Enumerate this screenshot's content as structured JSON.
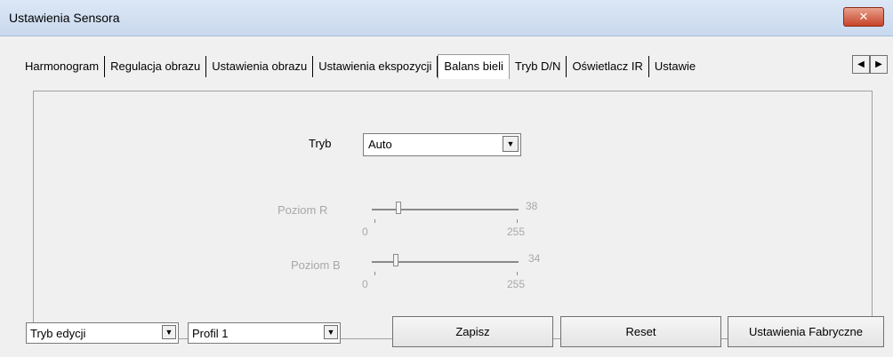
{
  "window": {
    "title": "Ustawienia Sensora",
    "close_glyph": "✕"
  },
  "tabs": [
    {
      "label": "Harmonogram"
    },
    {
      "label": "Regulacja obrazu"
    },
    {
      "label": "Ustawienia obrazu"
    },
    {
      "label": "Ustawienia ekspozycji"
    },
    {
      "label": "Balans bieli",
      "active": true
    },
    {
      "label": "Tryb D/N"
    },
    {
      "label": "Oświetlacz IR"
    },
    {
      "label": "Ustawie"
    }
  ],
  "tab_scroll": {
    "left": "◀",
    "right": "▶"
  },
  "panel": {
    "mode_label": "Tryb",
    "mode_value": "Auto",
    "slider_r": {
      "label": "Poziom R",
      "value": 38,
      "min": "0",
      "max": "255"
    },
    "slider_b": {
      "label": "Poziom B",
      "value": 34,
      "min": "0",
      "max": "255"
    }
  },
  "bottom": {
    "edit_mode": "Tryb edycji",
    "profile": "Profil 1",
    "save": "Zapisz",
    "reset": "Reset",
    "factory": "Ustawienia Fabryczne"
  },
  "icons": {
    "dropdown": "▼"
  }
}
